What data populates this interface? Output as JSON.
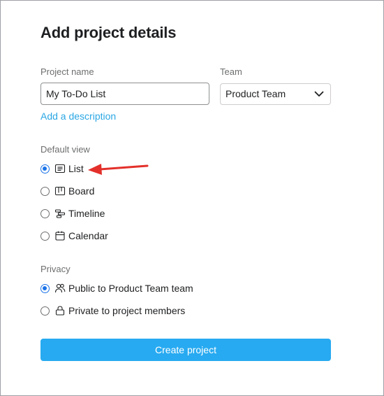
{
  "dialog": {
    "title": "Add project details"
  },
  "form": {
    "project_name_label": "Project name",
    "project_name_value": "My To-Do List",
    "team_label": "Team",
    "team_value": "Product Team",
    "add_description_label": "Add a description"
  },
  "default_view": {
    "label": "Default view",
    "options": [
      {
        "label": "List",
        "icon": "list-icon",
        "selected": true
      },
      {
        "label": "Board",
        "icon": "board-icon",
        "selected": false
      },
      {
        "label": "Timeline",
        "icon": "timeline-icon",
        "selected": false
      },
      {
        "label": "Calendar",
        "icon": "calendar-icon",
        "selected": false
      }
    ]
  },
  "privacy": {
    "label": "Privacy",
    "options": [
      {
        "label": "Public to Product Team team",
        "icon": "people-icon",
        "selected": true
      },
      {
        "label": "Private to project members",
        "icon": "lock-icon",
        "selected": false
      }
    ]
  },
  "actions": {
    "create_label": "Create project"
  },
  "annotation": {
    "icon": "red-arrow-icon",
    "color": "#e3302a"
  },
  "colors": {
    "accent": "#1a73e8",
    "button": "#27aaf1",
    "link": "#2ba7e4"
  }
}
